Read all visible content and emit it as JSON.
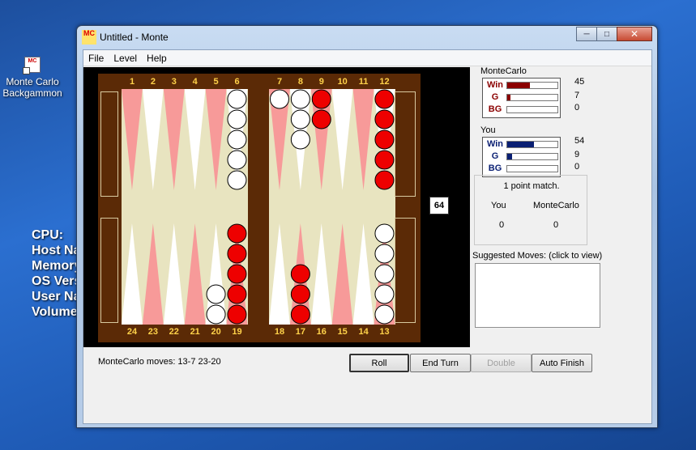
{
  "desktop": {
    "icon_label": "Monte Carlo Backgammon",
    "sysinfo_lines": [
      "CPU:",
      "Host Na",
      "Memory",
      "OS Vers",
      "User Na",
      "Volume"
    ]
  },
  "window": {
    "title": "Untitled - Monte",
    "app_icon_text": "MC",
    "menu": [
      "File",
      "Level",
      "Help"
    ]
  },
  "board": {
    "top_numbers": [
      "1",
      "2",
      "3",
      "4",
      "5",
      "6",
      "7",
      "8",
      "9",
      "10",
      "11",
      "12"
    ],
    "bottom_numbers": [
      "24",
      "23",
      "22",
      "21",
      "20",
      "19",
      "18",
      "17",
      "16",
      "15",
      "14",
      "13"
    ],
    "cube_value": "64",
    "colors": {
      "frame": "#5b2a06",
      "felt": "#e8e4c0",
      "point_light": "#ffffff",
      "point_dark": "#f79a99",
      "checker_red": "#ee0000",
      "checker_white": "#ffffff",
      "numbers": "#ffd24a"
    },
    "checkers": {
      "p6": {
        "color": "white",
        "count": 5
      },
      "p7": {
        "color": "white",
        "count": 1
      },
      "p8": {
        "color": "white",
        "count": 3
      },
      "p9": {
        "color": "red",
        "count": 2
      },
      "p12": {
        "color": "red",
        "count": 5
      },
      "p19": {
        "color": "red",
        "count": 5
      },
      "p20": {
        "color": "white",
        "count": 2
      },
      "p17": {
        "color": "red",
        "count": 3
      },
      "p13": {
        "color": "white",
        "count": 5
      }
    }
  },
  "panel": {
    "players": [
      {
        "name": "MonteCarlo",
        "label_color": "#8b0000",
        "rows": [
          {
            "label": "Win",
            "value": "45",
            "fraction": 0.45
          },
          {
            "label": "G",
            "value": "7",
            "fraction": 0.07
          },
          {
            "label": "BG",
            "value": "0",
            "fraction": 0.0
          }
        ]
      },
      {
        "name": "You",
        "label_color": "#0a1f73",
        "rows": [
          {
            "label": "Win",
            "value": "54",
            "fraction": 0.54
          },
          {
            "label": "G",
            "value": "9",
            "fraction": 0.09
          },
          {
            "label": "BG",
            "value": "0",
            "fraction": 0.0
          }
        ]
      }
    ],
    "match": {
      "title": "1 point match.",
      "player1": "You",
      "player2": "MonteCarlo",
      "score1": "0",
      "score2": "0"
    },
    "suggested_label": "Suggested Moves: (click to view)"
  },
  "status": "MonteCarlo moves: 13-7 23-20",
  "buttons": {
    "roll": "Roll",
    "end_turn": "End Turn",
    "double": "Double",
    "auto_finish": "Auto Finish"
  }
}
